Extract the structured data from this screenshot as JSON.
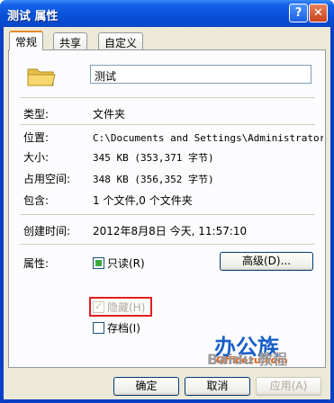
{
  "window": {
    "title": "测试 属性",
    "help": "?",
    "close": "✕"
  },
  "tabs": [
    {
      "label": "常规",
      "active": true
    },
    {
      "label": "共享",
      "active": false
    },
    {
      "label": "自定义",
      "active": false
    }
  ],
  "general": {
    "name": "测试",
    "type": {
      "label": "类型:",
      "value": "文件夹"
    },
    "location": {
      "label": "位置:",
      "value": "C:\\Documents and Settings\\Administrator\\桌"
    },
    "size": {
      "label": "大小:",
      "value": "345 KB (353,371 字节)"
    },
    "disk_size": {
      "label": "占用空间:",
      "value": "348 KB (356,352 字节)"
    },
    "contains": {
      "label": "包含:",
      "value": "1 个文件,0 个文件夹"
    },
    "created": {
      "label": "创建时间:",
      "value": "2012年8月8日 今天, 11:57:10"
    },
    "attributes": {
      "label": "属性:",
      "readonly": "只读(R)",
      "hidden": "隐藏(H)",
      "archive": "存档(I)",
      "advanced": "高级(D)..."
    }
  },
  "watermark": {
    "brand": "办公族",
    "url": "Officezu.com",
    "baidu": "Baidu 教程"
  },
  "buttons": {
    "ok": "确定",
    "cancel": "取消",
    "apply": "应用(A)"
  },
  "colors": {
    "title_bar": "#0a4fd8",
    "highlight": "#e02020",
    "tab_accent": "#e68b2c"
  }
}
